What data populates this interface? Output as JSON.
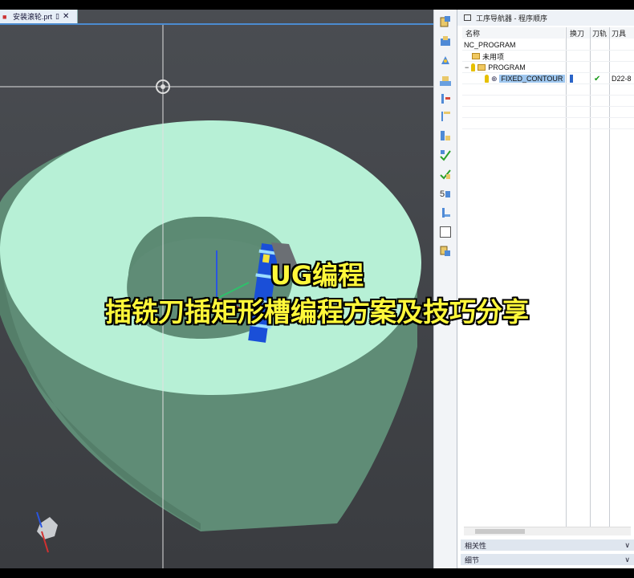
{
  "document_tab": {
    "filename": "安装滚轮.prt"
  },
  "navigator": {
    "title": "工序导航器 - 程序顺序",
    "columns": {
      "name": "名称",
      "tool_change": "换刀",
      "path": "刀轨",
      "tool": "刀具"
    },
    "tree": {
      "root": "NC_PROGRAM",
      "unused": "未用项",
      "program": "PROGRAM",
      "operation": {
        "name": "FIXED_CONTOUR",
        "path_status": "✔",
        "tool": "D22-8"
      }
    }
  },
  "panels": [
    {
      "label": "相关性",
      "icon": "chevron-down-icon"
    },
    {
      "label": "细节",
      "icon": "chevron-down-icon"
    }
  ],
  "caption": {
    "line1": "UG编程",
    "line2": "插铣刀插矩形槽编程方案及技巧分享"
  },
  "colors": {
    "part_face": "#b7f0d6",
    "part_side": "#5d8a74",
    "caption": "#fff83a",
    "selection": "#9fc7ef"
  },
  "icons": [
    "part-navigator-icon",
    "assembly-icon",
    "constraint-icon",
    "machine-icon",
    "program-order-icon",
    "machine-tool-icon",
    "geometry-view-icon",
    "method-view-icon",
    "verify-icon",
    "library-icon",
    "tool-icon",
    "measure-icon",
    "blank-icon",
    "history-icon"
  ]
}
